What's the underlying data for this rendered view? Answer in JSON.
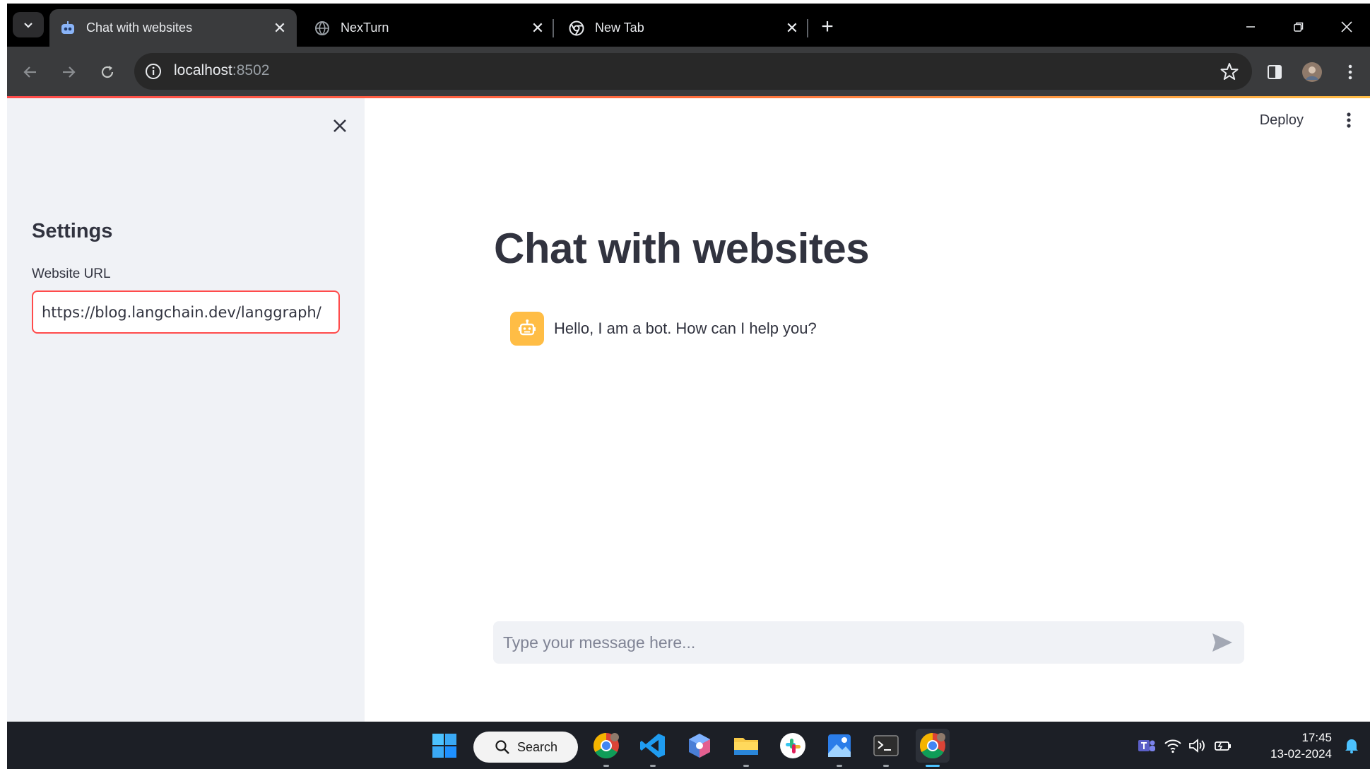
{
  "browser": {
    "tabs": [
      {
        "title": "Chat with websites",
        "active": true
      },
      {
        "title": "NexTurn",
        "active": false
      },
      {
        "title": "New Tab",
        "active": false
      }
    ],
    "address": {
      "host": "localhost",
      "port": ":8502"
    }
  },
  "sidebar": {
    "title": "Settings",
    "url_label": "Website URL",
    "url_value": "https://blog.langchain.dev/langgraph/"
  },
  "main": {
    "deploy_label": "Deploy",
    "title": "Chat with websites",
    "messages": [
      {
        "role": "bot",
        "text": "Hello, I am a bot. How can I help you?"
      }
    ],
    "input_placeholder": "Type your message here..."
  },
  "taskbar": {
    "search_label": "Search",
    "time": "17:45",
    "date": "13-02-2024"
  },
  "colors": {
    "accent": "#ff4b4b",
    "bot_avatar": "#ffbd45",
    "sidebar_bg": "#f0f2f6",
    "text": "#31333f"
  }
}
